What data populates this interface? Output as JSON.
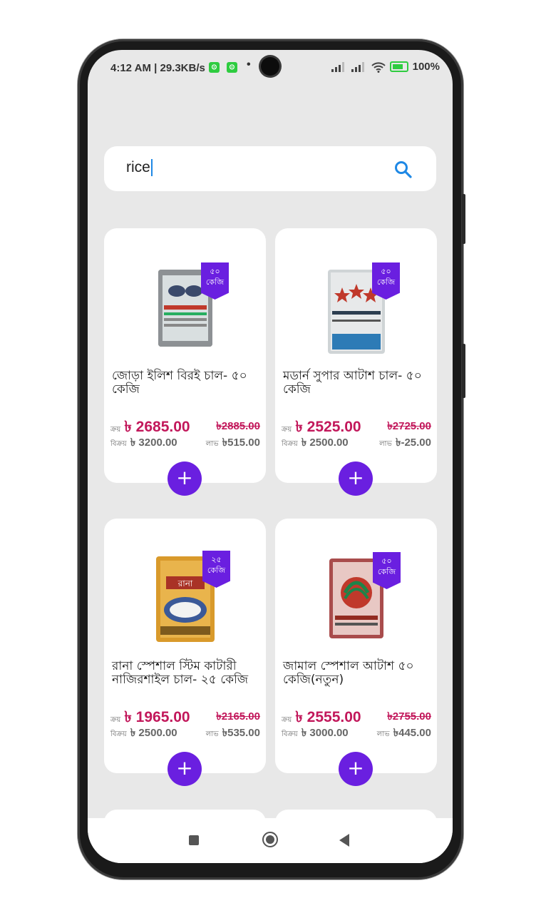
{
  "status_bar": {
    "time_speed": "4:12 AM | 29.3KB/s",
    "dot": "•",
    "battery": "100%"
  },
  "search": {
    "value": "rice"
  },
  "products": [
    {
      "badge_line1": "৫০",
      "badge_line2": "কেজি",
      "title": "জোড়া ইলিশ বিরই চাল- ৫০ কেজি",
      "buy_label": "ক্রয়",
      "buy_price": "৳ 2685.00",
      "old_price": "৳2885.00",
      "sell_label": "বিক্রয়",
      "sell_price": "৳ 3200.00",
      "profit_label": "লাভ",
      "profit_value": "৳515.00",
      "add_label": "+"
    },
    {
      "badge_line1": "৫০",
      "badge_line2": "কেজি",
      "title": "মডার্ন সুপার আটাশ চাল- ৫০ কেজি",
      "buy_label": "ক্রয়",
      "buy_price": "৳ 2525.00",
      "old_price": "৳2725.00",
      "sell_label": "বিক্রয়",
      "sell_price": "৳ 2500.00",
      "profit_label": "লাভ",
      "profit_value": "৳-25.00",
      "add_label": "+"
    },
    {
      "badge_line1": "২৫",
      "badge_line2": "কেজি",
      "title": "রানা স্পেশাল স্টিম কাটারী নাজিরশাইল চাল- ২৫ কেজি",
      "buy_label": "ক্রয়",
      "buy_price": "৳ 1965.00",
      "old_price": "৳2165.00",
      "sell_label": "বিক্রয়",
      "sell_price": "৳ 2500.00",
      "profit_label": "লাভ",
      "profit_value": "৳535.00",
      "add_label": "+"
    },
    {
      "badge_line1": "৫০",
      "badge_line2": "কেজি",
      "title": "জামাল স্পেশাল আটাশ ৫০ কেজি(নতুন)",
      "buy_label": "ক্রয়",
      "buy_price": "৳ 2555.00",
      "old_price": "৳2755.00",
      "sell_label": "বিক্রয়",
      "sell_price": "৳ 3000.00",
      "profit_label": "লাভ",
      "profit_value": "৳445.00",
      "add_label": "+"
    }
  ],
  "colors": {
    "accent_purple": "#6a1fe0",
    "price_pink": "#c2185b",
    "search_icon_blue": "#1e88e5",
    "screen_bg": "#e8e8e8"
  }
}
